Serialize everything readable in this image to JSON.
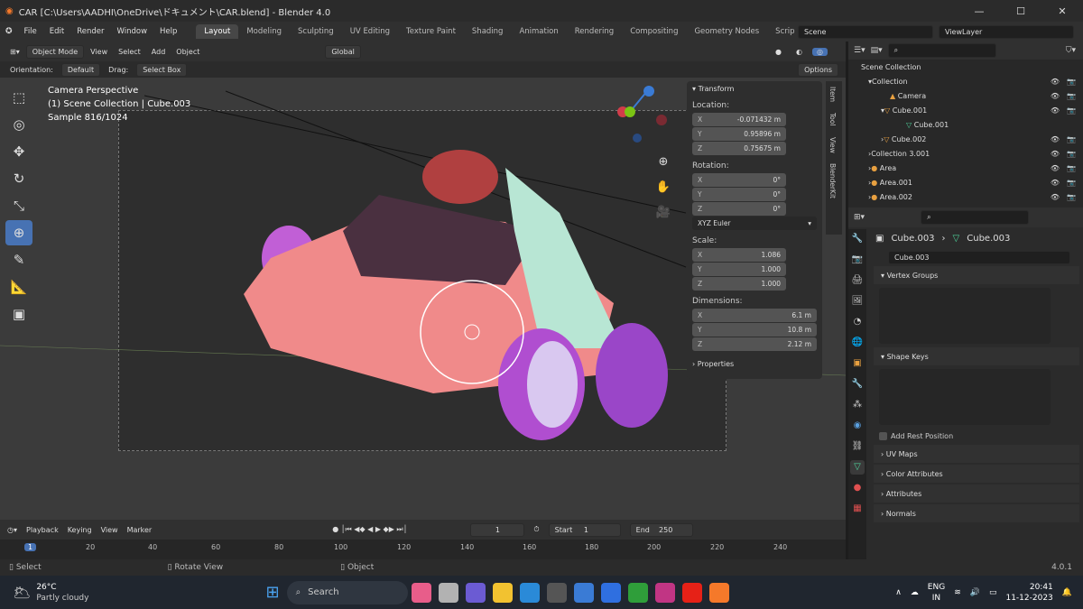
{
  "window": {
    "title": "CAR [C:\\Users\\AADHI\\OneDrive\\ドキュメント\\CAR.blend] - Blender 4.0",
    "min": "—",
    "max": "☐",
    "close": "✕"
  },
  "menu": [
    "File",
    "Edit",
    "Render",
    "Window",
    "Help"
  ],
  "workspaces": [
    "Layout",
    "Modeling",
    "Sculpting",
    "UV Editing",
    "Texture Paint",
    "Shading",
    "Animation",
    "Rendering",
    "Compositing",
    "Geometry Nodes",
    "Scripting",
    "+"
  ],
  "scene": "Scene",
  "view_layer": "ViewLayer",
  "viewport_header": {
    "mode": "Object Mode",
    "view": "View",
    "select": "Select",
    "add": "Add",
    "object": "Object",
    "transform": "Global"
  },
  "tool_header": {
    "orientation_label": "Orientation:",
    "orientation": "Default",
    "drag_label": "Drag:",
    "drag": "Select Box",
    "options": "Options"
  },
  "viewport_info": {
    "line1": "Camera Perspective",
    "line2": "(1) Scene Collection | Cube.003",
    "line3": "Sample 816/1024"
  },
  "npanel": {
    "section": "Transform",
    "location_label": "Location:",
    "location": [
      {
        "k": "X",
        "v": "-0.071432 m"
      },
      {
        "k": "Y",
        "v": "0.95896 m"
      },
      {
        "k": "Z",
        "v": "0.75675 m"
      }
    ],
    "rotation_label": "Rotation:",
    "rotation": [
      {
        "k": "X",
        "v": "0°"
      },
      {
        "k": "Y",
        "v": "0°"
      },
      {
        "k": "Z",
        "v": "0°"
      }
    ],
    "rotation_mode": "XYZ Euler",
    "scale_label": "Scale:",
    "scale": [
      {
        "k": "X",
        "v": "1.086"
      },
      {
        "k": "Y",
        "v": "1.000"
      },
      {
        "k": "Z",
        "v": "1.000"
      }
    ],
    "dimensions_label": "Dimensions:",
    "dimensions": [
      {
        "k": "X",
        "v": "6.1 m"
      },
      {
        "k": "Y",
        "v": "10.8 m"
      },
      {
        "k": "Z",
        "v": "2.12 m"
      }
    ],
    "properties": "Properties",
    "tabs": [
      "Item",
      "Tool",
      "View",
      "BlenderKit"
    ]
  },
  "timeline": {
    "playback": "Playback",
    "keying": "Keying",
    "view": "View",
    "marker": "Marker",
    "current": "1",
    "start_label": "Start",
    "start": "1",
    "end_label": "End",
    "end": "250",
    "ticks": [
      "1",
      "20",
      "40",
      "60",
      "80",
      "100",
      "120",
      "140",
      "160",
      "180",
      "200",
      "220",
      "240"
    ]
  },
  "status": {
    "select": "Select",
    "rotate": "Rotate View",
    "object": "Object",
    "version": "4.0.1"
  },
  "outliner": {
    "rows": [
      "Scene Collection",
      "Collection",
      "Camera",
      "Cube.001",
      "Cube.001",
      "Cube.002",
      "Collection 3.001",
      "Area",
      "Area.001",
      "Area.002"
    ]
  },
  "properties": {
    "breadcrumb_obj": "Cube.003",
    "breadcrumb_data": "Cube.003",
    "mesh_name": "Cube.003",
    "vertex_groups": "Vertex Groups",
    "shape_keys": "Shape Keys",
    "add_rest": "Add Rest Position",
    "sections": [
      "UV Maps",
      "Color Attributes",
      "Attributes",
      "Normals"
    ]
  },
  "taskbar": {
    "temp": "26°C",
    "weather": "Partly cloudy",
    "search": "Search",
    "lang1": "ENG",
    "lang2": "IN",
    "time": "20:41",
    "date": "11-12-2023"
  }
}
